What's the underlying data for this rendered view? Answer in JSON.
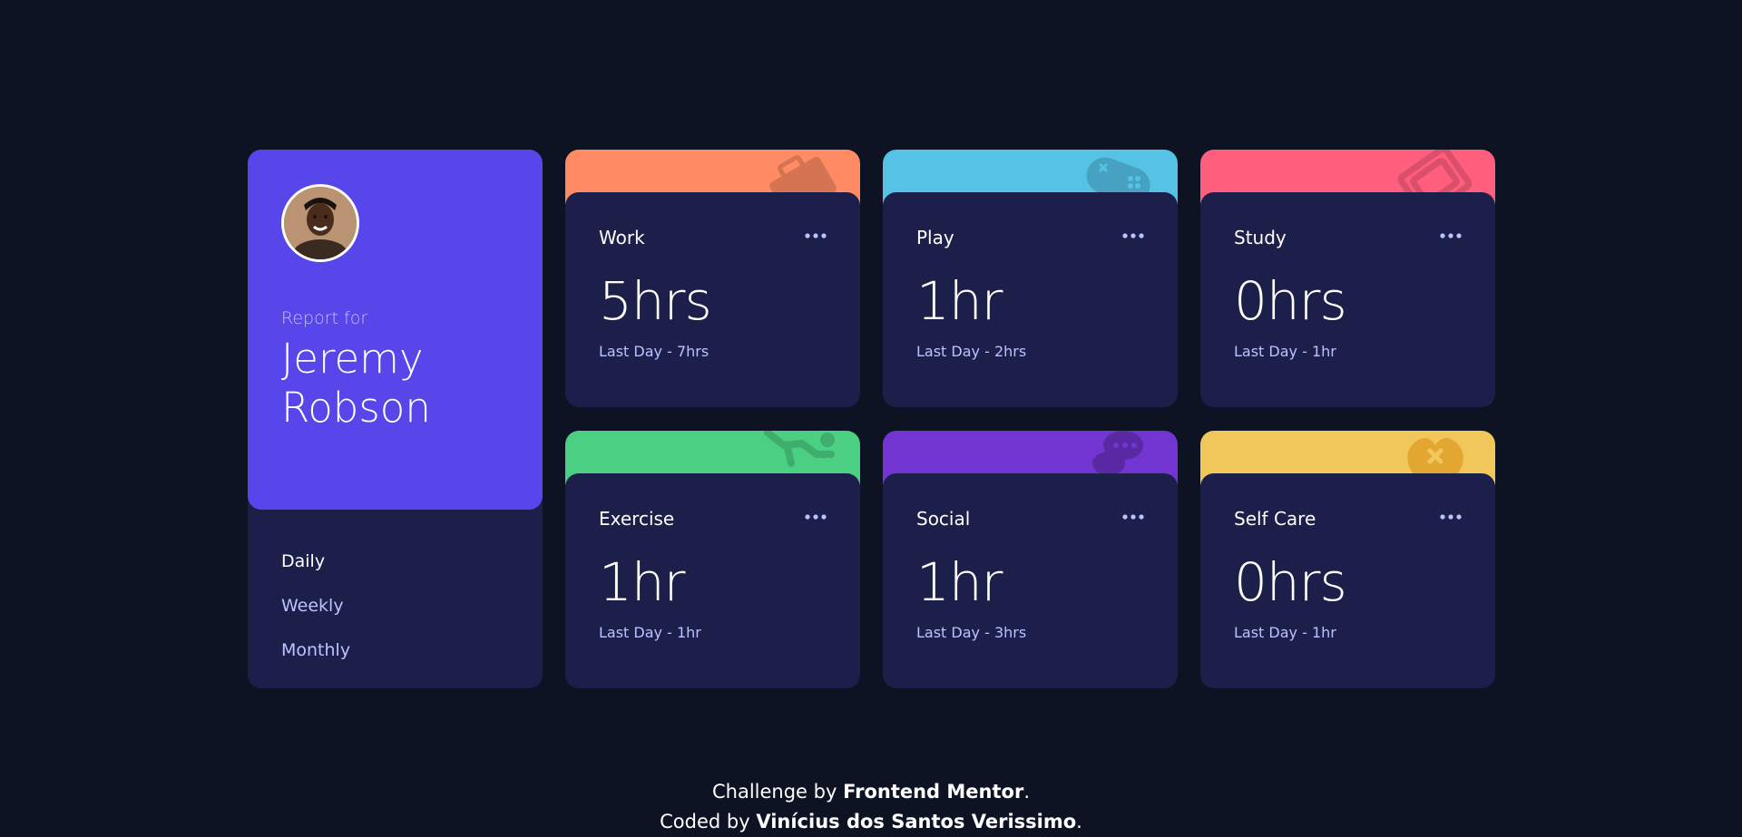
{
  "profile": {
    "report_for": "Report for",
    "name": "Jeremy Robson",
    "periods": [
      "Daily",
      "Weekly",
      "Monthly"
    ],
    "active_period": "Daily"
  },
  "cards": [
    {
      "title": "Work",
      "current": "5hrs",
      "previous": "Last Day - 7hrs",
      "color": "#ff8b64",
      "icon": "briefcase-icon"
    },
    {
      "title": "Play",
      "current": "1hr",
      "previous": "Last Day - 2hrs",
      "color": "#55c2e6",
      "icon": "gamepad-icon"
    },
    {
      "title": "Study",
      "current": "0hrs",
      "previous": "Last Day - 1hr",
      "color": "#ff5e7d",
      "icon": "book-icon"
    },
    {
      "title": "Exercise",
      "current": "1hr",
      "previous": "Last Day - 1hr",
      "color": "#4bcf82",
      "icon": "runner-icon"
    },
    {
      "title": "Social",
      "current": "1hr",
      "previous": "Last Day - 3hrs",
      "color": "#7335d2",
      "icon": "chat-icon"
    },
    {
      "title": "Self Care",
      "current": "0hrs",
      "previous": "Last Day - 1hr",
      "color": "#f1c75b",
      "icon": "heart-icon"
    }
  ],
  "footer": {
    "line1_prefix": "Challenge by ",
    "line1_link": "Frontend Mentor",
    "line1_suffix": ".",
    "line2_prefix": "Coded by ",
    "line2_link": "Vinícius dos Santos Verissimo",
    "line2_suffix": "."
  }
}
